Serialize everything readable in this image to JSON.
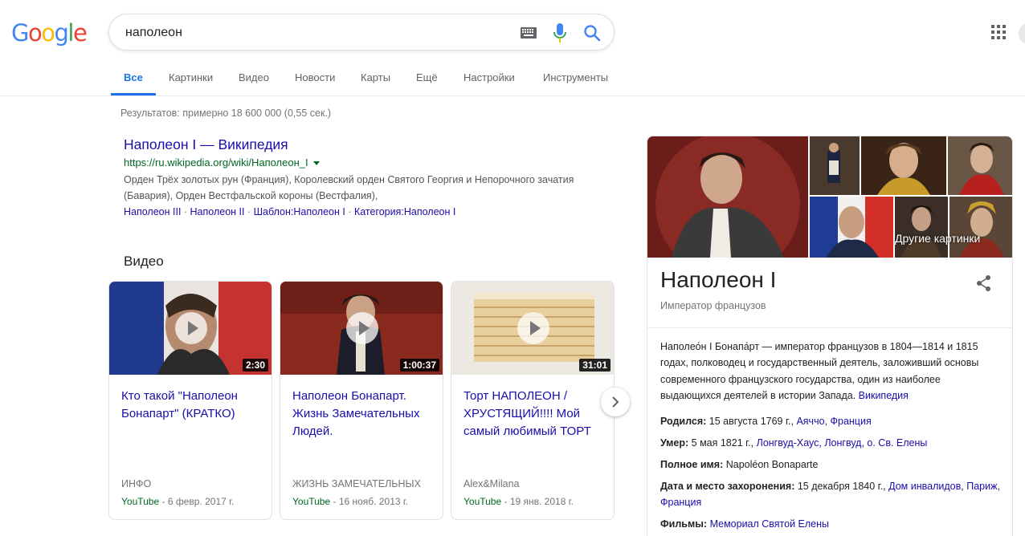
{
  "logo": {
    "letters": [
      "G",
      "o",
      "o",
      "g",
      "l",
      "e"
    ],
    "colors": [
      "#4285f4",
      "#ea4335",
      "#fbbc05",
      "#4285f4",
      "#34a853",
      "#ea4335"
    ]
  },
  "search": {
    "query": "наполеон",
    "keyboard_icon": "keyboard-icon",
    "mic_icon": "mic-icon",
    "search_icon": "search-icon"
  },
  "tabs": [
    {
      "label": "Все",
      "active": true
    },
    {
      "label": "Картинки"
    },
    {
      "label": "Видео"
    },
    {
      "label": "Новости"
    },
    {
      "label": "Карты"
    },
    {
      "label": "Ещё"
    },
    {
      "label": "Настройки"
    },
    {
      "label": "Инструменты"
    }
  ],
  "result_stats": "Результатов: примерно 18 600 000 (0,55 сек.)",
  "wiki": {
    "title": "Наполеон I — Википедия",
    "url": "https://ru.wikipedia.org/wiki/Наполеон_I",
    "snippet": "Орден Трёх золотых рун (Франция), Королевский орден Святого Георгия и Непорочного зачатия (Бавария), Орден Вестфальской короны (Вестфалия),",
    "sitelinks": [
      "Наполеон III",
      "Наполеон II",
      "Шаблон:Наполеон I",
      "Категория:Наполеон I"
    ],
    "separator": " · "
  },
  "videos_heading": "Видео",
  "videos": [
    {
      "title": "Кто такой \"Наполеон Бонапарт\" (КРАТКО)",
      "duration": "2:30",
      "channel": "ИНФО",
      "source": "YouTube",
      "date": " - 6 февр. 2017 г."
    },
    {
      "title": "Наполеон Бонапарт. Жизнь Замечательных Людей.",
      "duration": "1:00:37",
      "channel": "ЖИЗНЬ ЗАМЕЧАТЕЛЬНЫХ",
      "source": "YouTube",
      "date": " - 16 нояб. 2013 г."
    },
    {
      "title": "Торт НАПОЛЕОН / ХРУСТЯЩИЙ!!!! Мой самый любимый ТОРТ",
      "duration": "31:01",
      "channel": "Alex&Milana",
      "source": "YouTube",
      "date": " - 19 янв. 2018 г."
    }
  ],
  "kp": {
    "more_images": "Другие картинки",
    "title": "Наполеон I",
    "subtitle": "Император французов",
    "description": "Наполео́н I Бонапа́рт — император французов в 1804—1814 и 1815 годах, полководец и государственный деятель, заложивший основы современного французского государства, один из наиболее выдающихся деятелей в истории Запада.",
    "description_source": "Википедия",
    "facts": {
      "born_label": "Родился:",
      "born_date": "15 августа 1769 г.,",
      "born_place1": "Аяччо",
      "born_place2": "Франция",
      "died_label": "Умер:",
      "died_date": "5 мая 1821 г.,",
      "died_place": "Лонгвуд-Хаус, Лонгвуд, о. Св. Елены",
      "fullname_label": "Полное имя:",
      "fullname": "Napoléon Bonaparte",
      "burial_label": "Дата и место захоронения:",
      "burial_date": "15 декабря 1840 г.,",
      "burial_place1": "Дом инвалидов",
      "burial_place2": "Париж",
      "burial_place3": "Франция",
      "films_label": "Фильмы:",
      "films": "Мемориал Святой Елены"
    }
  },
  "colors": {
    "link": "#1a0dab",
    "url": "#006621",
    "accent": "#1a73e8",
    "gray": "#70757a"
  }
}
